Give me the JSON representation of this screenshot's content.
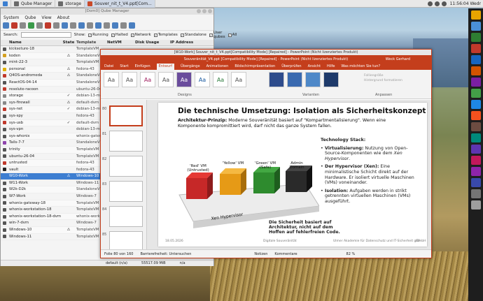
{
  "taskbar": {
    "apps": [
      {
        "label": "Qube Manager",
        "icon": "qube-icon",
        "active": false
      },
      {
        "label": "storage",
        "icon": "folder-icon",
        "active": false
      },
      {
        "label": "Souver_nit_t_V4.ppt[Com...",
        "icon": "powerpoint-icon",
        "active": true
      }
    ],
    "clock": "11:56:04 Wedr"
  },
  "qube_manager": {
    "window_title": "[Dom0] Qube Manager",
    "menu": [
      "System",
      "Qube",
      "View",
      "About"
    ],
    "search_label": "Search:",
    "search_value": "",
    "show_label": "Show:",
    "filters": [
      "Running",
      "Halted",
      "Network",
      "Templates",
      "Standalone",
      "User qubes",
      "All"
    ],
    "columns": [
      "Name",
      "State",
      "Template",
      "NetVM",
      "Disk Usage",
      "IP Address"
    ],
    "rows": [
      {
        "name": "kickseture-18",
        "template": "TemplateVM",
        "net": "",
        "color": "#555555",
        "state": ""
      },
      {
        "name": "koden",
        "template": "StandaloneVM",
        "net": "",
        "color": "#d4a020",
        "state": "⚠"
      },
      {
        "name": "mint-22-3",
        "template": "TemplateVM",
        "net": "",
        "color": "#555555",
        "state": ""
      },
      {
        "name": "personal",
        "template": "fedora-43",
        "net": "",
        "color": "#e0b000",
        "state": "⚠"
      },
      {
        "name": "Q4OS-andromeda",
        "template": "StandaloneVM",
        "net": "",
        "color": "#c0392b",
        "state": "⚠"
      },
      {
        "name": "ReactOS-04-14",
        "template": "StandaloneVM",
        "net": "",
        "color": "#555555",
        "state": ""
      },
      {
        "name": "resolute-racoon",
        "template": "ubuntu-26-04",
        "net": "",
        "color": "#c0392b",
        "state": ""
      },
      {
        "name": "storage",
        "template": "debian-13-mir",
        "net": "",
        "color": "#888888",
        "state": "✓"
      },
      {
        "name": "sys-firewall",
        "template": "default-dvm",
        "net": "",
        "color": "#888888",
        "state": "⚠"
      },
      {
        "name": "sys-net",
        "template": "debian-13-mir",
        "net": "",
        "color": "#c0392b",
        "state": "✓"
      },
      {
        "name": "sys-spy",
        "template": "fedora-43",
        "net": "",
        "color": "#555555",
        "state": ""
      },
      {
        "name": "sys-usb",
        "template": "default-dvm",
        "net": "",
        "color": "#c0392b",
        "state": "✓"
      },
      {
        "name": "sys-vpn",
        "template": "debian-13-mir",
        "net": "",
        "color": "#555555",
        "state": ""
      },
      {
        "name": "sys-whonix",
        "template": "whonix-gatew",
        "net": "",
        "color": "#555555",
        "state": ""
      },
      {
        "name": "Tails-7-7",
        "template": "StandaloneVM",
        "net": "",
        "color": "#8e44ad",
        "state": ""
      },
      {
        "name": "trinity",
        "template": "TemplateVM",
        "net": "",
        "color": "#555555",
        "state": ""
      },
      {
        "name": "ubuntu-26-04",
        "template": "TemplateVM",
        "net": "",
        "color": "#555555",
        "state": ""
      },
      {
        "name": "untrusted",
        "template": "fedora-43",
        "net": "",
        "color": "#c0392b",
        "state": ""
      },
      {
        "name": "vault",
        "template": "fedora-43",
        "net": "",
        "color": "#222222",
        "state": ""
      },
      {
        "name": "W10-Work",
        "template": "Windows-10",
        "net": "",
        "color": "#3d7ed1",
        "state": "⚠",
        "selected": true
      },
      {
        "name": "W11-Work",
        "template": "Windows-11",
        "net": "",
        "color": "#555555",
        "state": ""
      },
      {
        "name": "W2k-D2k",
        "template": "StandaloneVM",
        "net": "",
        "color": "#555555",
        "state": ""
      },
      {
        "name": "W7-Work",
        "template": "Windows-7",
        "net": "",
        "color": "#555555",
        "state": ""
      },
      {
        "name": "whonix-gateway-18",
        "template": "TemplateVM",
        "net": "",
        "color": "#555555",
        "state": ""
      },
      {
        "name": "whonix-workstation-18",
        "template": "TemplateVM",
        "net": "",
        "color": "#555555",
        "state": ""
      },
      {
        "name": "whonix-workstation-18-dvm",
        "template": "whonix-works",
        "net": "",
        "color": "#555555",
        "state": ""
      },
      {
        "name": "win-7-dvm",
        "template": "Windows-7",
        "net": "",
        "color": "#555555",
        "state": ""
      },
      {
        "name": "Windows-10",
        "template": "TemplateVM",
        "net": "",
        "color": "#555555",
        "state": "⚠"
      },
      {
        "name": "Windows-11",
        "template": "TemplateVM",
        "net": "",
        "color": "#555555",
        "state": ""
      }
    ],
    "status": {
      "netvm": "default (n/a)",
      "disk": "55517.09 MiB",
      "ip": "n/a"
    }
  },
  "powerpoint": {
    "outer_title": "[W10-Work] Souver_nit_t_V4.ppt[Compatibility Mode] [Repaired] - PowerPoint (Nicht lizenziertes Produkt)",
    "title": "Souveränität_V4.ppt [Compatibility Mode] [Repaired] - PowerPoint (Nicht lizenziertes Produkt)",
    "user": "Weck Gerhard",
    "tabs": [
      "Datei",
      "Start",
      "Einfügen",
      "Entwurf",
      "Übergänge",
      "Animationen",
      "Bildschirmpräsentation",
      "Überprüfen",
      "Ansicht",
      "Hilfe",
      "Was möchten Sie tun?"
    ],
    "active_tab": "Entwurf",
    "ribbon_groups": [
      "Designs",
      "Varianten",
      "Anpassen"
    ],
    "ribbon_buttons": [
      "Folliengröße",
      "Hintergrund formatieren"
    ],
    "slide_numbers": [
      "80",
      "81",
      "82",
      "83",
      "84",
      "85"
    ],
    "slide": {
      "title": "Die technische Umsetzung: Isolation als Sicherheitskonzept",
      "arch_label": "Architektur-Prinzip:",
      "arch_text": " Moderne Souveränität basiert auf \"Kompartmentalisierung\". Wenn eine Komponente kompromittiert wird, darf nicht das ganze System fallen.",
      "vm_labels": [
        "'Red' VM\n(Untrusted)",
        "'Yellow' VM",
        "'Green' VM\n(Safe)",
        "Admin\nDomain"
      ],
      "hypervisor_label": "Xen Hypervisor",
      "caption": "Die Sicherheit basiert auf Architektur, nicht auf dem Hoffen auf fehlerfreien Code.",
      "stack_heading": "Technology Stack:",
      "stack": [
        {
          "bold": "Virtualisierung:",
          "text": " Nutzung von Open-Source-Komponenten wie dem ",
          "italic": "Xen Hypervisor",
          "tail": "."
        },
        {
          "bold": "Der Hypervisor (Xen):",
          "text": " Eine minimalistische Schicht direkt auf der Hardware. Er isoliert virtuelle Maschinen (VMs) voneinander.",
          "italic": "",
          "tail": ""
        },
        {
          "bold": "Isolation:",
          "text": " Aufgaben werden in strikt getrennten virtuellen Maschinen (VMs) ausgeführt.",
          "italic": "",
          "tail": ""
        }
      ],
      "footer_date": "18.05.2026",
      "footer_center": "Digitale Souveränität",
      "footer_right": "Ulmer Akademie für Datenschutz und IT-Sicherheit gGmbH",
      "page_num": "80"
    },
    "status": {
      "slide_info": "Folie 80 von 160",
      "accessibility": "Barrierefreiheit: Untersuchen",
      "notes": "Notizen",
      "comments": "Kommentare",
      "zoom": "82 %"
    }
  },
  "colors": {
    "ppt_accent": "#c43e1c",
    "select_blue": "#3d7ed1"
  }
}
